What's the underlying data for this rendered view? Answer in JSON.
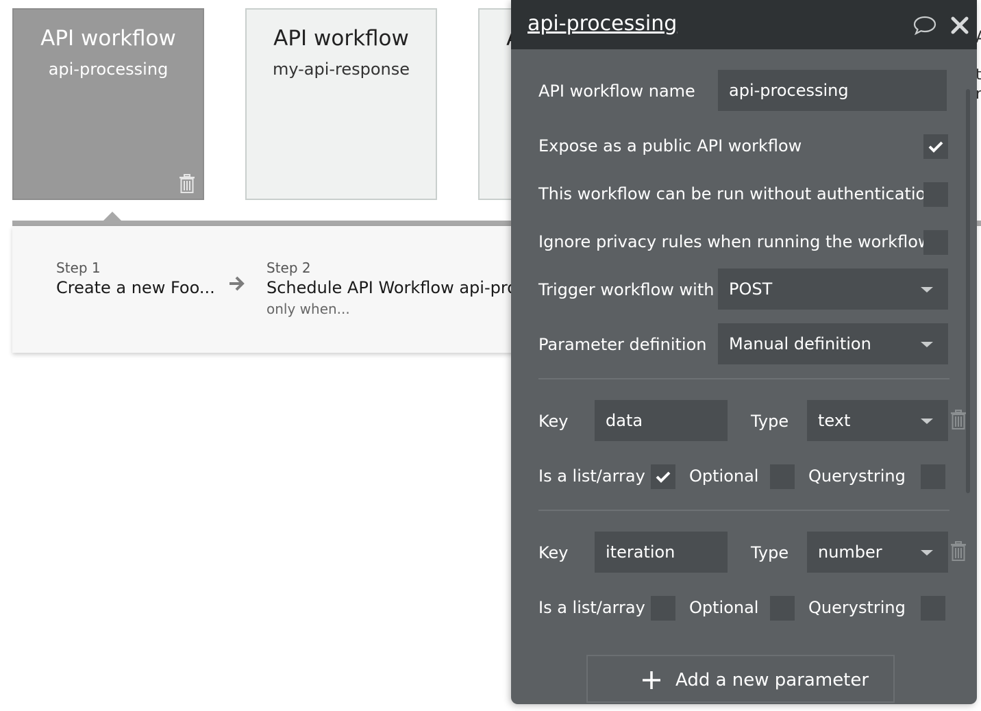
{
  "cards": [
    {
      "title": "API workflow",
      "subtitle": "api-processing",
      "selected": true
    },
    {
      "title": "API workflow",
      "subtitle": "my-api-response",
      "selected": false
    },
    {
      "title": "API workflow",
      "subtitle": "",
      "selected": false
    }
  ],
  "steps": [
    {
      "label": "Step 1",
      "name": "Create a new Foo...",
      "condition": ""
    },
    {
      "label": "Step 2",
      "name": "Schedule API Workflow api-processing",
      "condition": "only when..."
    }
  ],
  "panel": {
    "title": "api-processing",
    "name_label": "API workflow name",
    "name_value": "api-processing",
    "expose_label": "Expose as a public API workflow",
    "expose_checked": true,
    "noauth_label": "This workflow can be run without authentication",
    "noauth_checked": false,
    "privacy_label": "Ignore privacy rules when running the workflow",
    "privacy_checked": false,
    "trigger_label": "Trigger workflow with",
    "trigger_value": "POST",
    "paramdef_label": "Parameter definition",
    "paramdef_value": "Manual definition",
    "key_label": "Key",
    "type_label": "Type",
    "list_label": "Is a list/array",
    "optional_label": "Optional",
    "querystring_label": "Querystring",
    "parameters": [
      {
        "key": "data",
        "type": "text",
        "is_list": true,
        "optional": false,
        "querystring": false
      },
      {
        "key": "iteration",
        "type": "number",
        "is_list": false,
        "optional": false,
        "querystring": false
      }
    ],
    "add_button_label": "Add a new parameter"
  },
  "colors": {
    "panel_bg": "#5c6063",
    "panel_header": "#2e3234",
    "field_bg": "#4a4e51",
    "selected_card": "#999999"
  }
}
